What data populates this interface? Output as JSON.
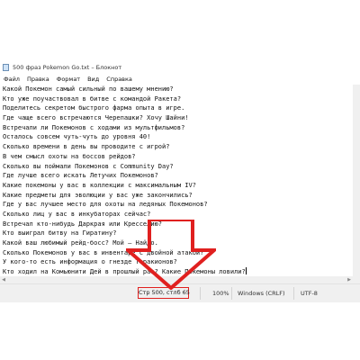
{
  "window": {
    "title": "500 фраз Pokemon Go.txt – Блокнот"
  },
  "menu": [
    "Файл",
    "Правка",
    "Формат",
    "Вид",
    "Справка"
  ],
  "editor": {
    "lines": [
      "Какой Покемон самый сильный по вашему мнению?",
      "Кто уже поучаствовал в битве с командой Ракета?",
      "Поделитесь секретом быстрого фарма опыта в игре.",
      "Где чаще всего встречаются Черепашки? Хочу Шайни!",
      "Встречали ли Покемонов с ходами из мультфильмов?",
      "Осталось совсем чуть-чуть до уровня 40!",
      "Сколько времени в день вы проводите с игрой?",
      "В чем смысл охоты на боссов рейдов?",
      "Сколько вы поймали Покемонов с Community Day?",
      "Где лучше всего искать Летучих Покемонов?",
      "Какие покемоны у вас в коллекции с максимальным IV?",
      "Какие предметы для эволюции у вас уже закончились?",
      "Где у вас лучшее место для охоты на ледяных Покемонов?",
      "Сколько лиц у вас в инкубаторах сейчас?",
      "Встречал кто-нибудь Даркрая или Кресселию?",
      "Кто выиграл битву на Гиратину?",
      "Какой ваш любимый рейд-босс? Мой – Найдо.",
      "Сколько Покемонов у вас в инвентаре с двойной атакой?",
      "У кого-то есть информация о гнезде Теракионов?",
      "Кто ходил на Комьюнити Дей в прошлый раз? Какие Покемоны ловили?"
    ]
  },
  "status": {
    "position": "Стр 500, стлб 65",
    "zoom": "100%",
    "line_ending": "Windows (CRLF)",
    "encoding": "UTF-8"
  },
  "colors": {
    "annotation": "#e0201f"
  }
}
